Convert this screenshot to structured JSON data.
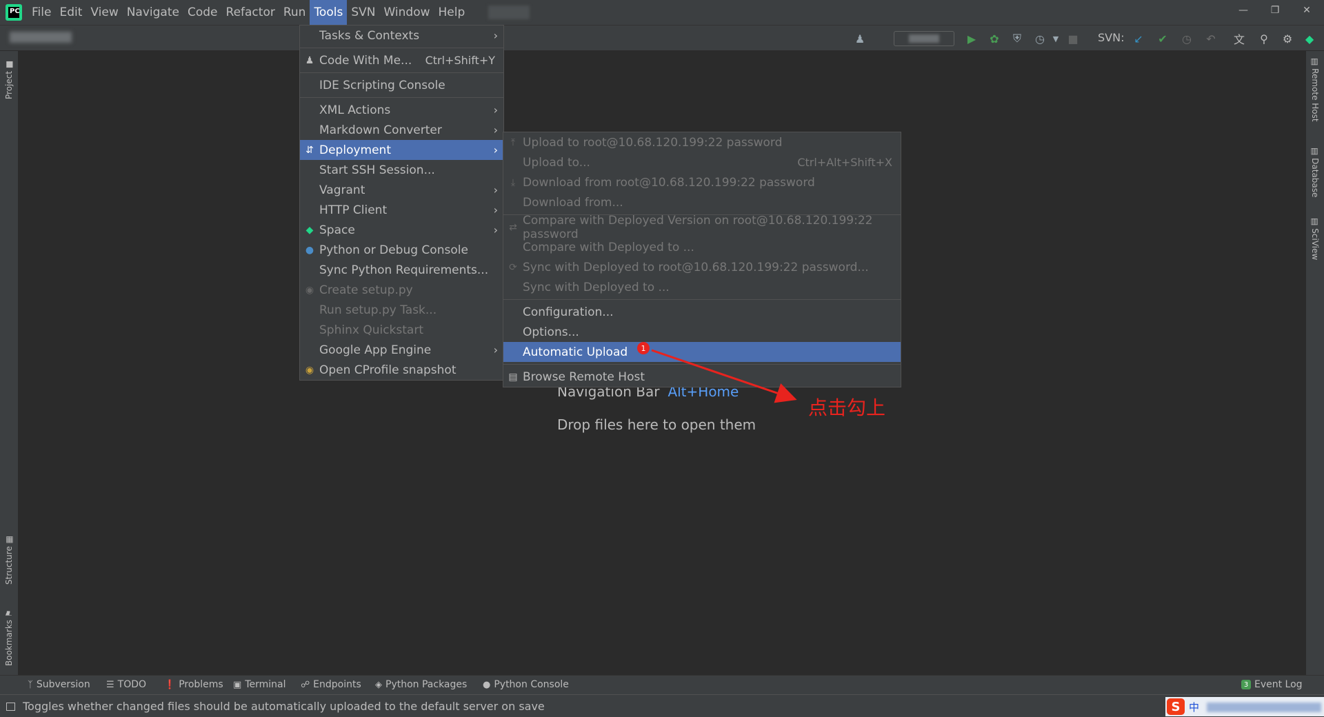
{
  "menubar": {
    "items": [
      "File",
      "Edit",
      "View",
      "Navigate",
      "Code",
      "Refactor",
      "Run",
      "Tools",
      "SVN",
      "Window",
      "Help"
    ],
    "active": "Tools"
  },
  "toolbar": {
    "svn_label": "SVN:"
  },
  "side_tabs": {
    "left": [
      "Project",
      "Structure",
      "Bookmarks"
    ],
    "right": [
      "Remote Host",
      "Database",
      "SciView"
    ]
  },
  "tools_menu": [
    {
      "label": "Tasks & Contexts",
      "submenu": true
    },
    {
      "label": "Code With Me...",
      "shortcut": "Ctrl+Shift+Y",
      "icon": "users-icon"
    },
    {
      "label": "IDE Scripting Console"
    },
    {
      "label": "XML Actions",
      "submenu": true
    },
    {
      "label": "Markdown Converter",
      "submenu": true
    },
    {
      "label": "Deployment",
      "submenu": true,
      "selected": true,
      "icon": "deploy-arrows-icon"
    },
    {
      "label": "Start SSH Session..."
    },
    {
      "label": "Vagrant",
      "submenu": true
    },
    {
      "label": "HTTP Client",
      "submenu": true
    },
    {
      "label": "Space",
      "submenu": true,
      "icon": "space-icon"
    },
    {
      "label": "Python or Debug Console",
      "icon": "python-icon"
    },
    {
      "label": "Sync Python Requirements..."
    },
    {
      "label": "Create setup.py",
      "disabled": true,
      "icon": "python-package-icon"
    },
    {
      "label": "Run setup.py Task...",
      "disabled": true
    },
    {
      "label": "Sphinx Quickstart",
      "disabled": true
    },
    {
      "label": "Google App Engine",
      "submenu": true
    },
    {
      "label": "Open CProfile snapshot",
      "icon": "cprofile-icon"
    }
  ],
  "deployment_menu": {
    "group1": [
      {
        "label": "Upload to root@10.68.120.199:22 password",
        "icon": "upload-icon"
      },
      {
        "label": "Upload to...",
        "shortcut": "Ctrl+Alt+Shift+X"
      },
      {
        "label": "Download from root@10.68.120.199:22 password",
        "icon": "download-icon"
      },
      {
        "label": "Download from..."
      }
    ],
    "group2": [
      {
        "label": "Compare with Deployed Version on root@10.68.120.199:22 password",
        "icon": "compare-icon"
      },
      {
        "label": "Compare with Deployed to ..."
      },
      {
        "label": "Sync with Deployed to root@10.68.120.199:22 password...",
        "icon": "sync-icon"
      },
      {
        "label": "Sync with Deployed to ..."
      }
    ],
    "group3": [
      {
        "label": "Configuration..."
      },
      {
        "label": "Options..."
      },
      {
        "label": "Automatic Upload",
        "selected": true
      }
    ],
    "group4": [
      {
        "label": "Browse Remote Host",
        "icon": "remote-host-icon"
      }
    ]
  },
  "editor_hints": {
    "nav_bar_label": "Navigation Bar",
    "nav_bar_key": "Alt+Home",
    "drop_files": "Drop files here to open them"
  },
  "annotation": {
    "badge": "1",
    "text": "点击勾上",
    "color": "#e8231e"
  },
  "tool_windows": [
    {
      "label": "Subversion",
      "icon": "subversion-icon"
    },
    {
      "label": "TODO",
      "icon": "todo-icon"
    },
    {
      "label": "Problems",
      "icon": "problems-icon"
    },
    {
      "label": "Terminal",
      "icon": "terminal-icon"
    },
    {
      "label": "Endpoints",
      "icon": "endpoints-icon"
    },
    {
      "label": "Python Packages",
      "icon": "packages-icon"
    },
    {
      "label": "Python Console",
      "icon": "python-icon"
    }
  ],
  "event_log": {
    "label": "Event Log",
    "count": "3"
  },
  "statusbar": {
    "text": "Toggles whether changed files should be automatically uploaded to the default server on save",
    "ime_char": "中",
    "ime_logo": "S"
  },
  "colors": {
    "accent_selection": "#4b6eaf",
    "panel": "#3c3f41",
    "editor_bg": "#2b2b2b",
    "run_green": "#499c54",
    "annotation_red": "#e8231e"
  }
}
